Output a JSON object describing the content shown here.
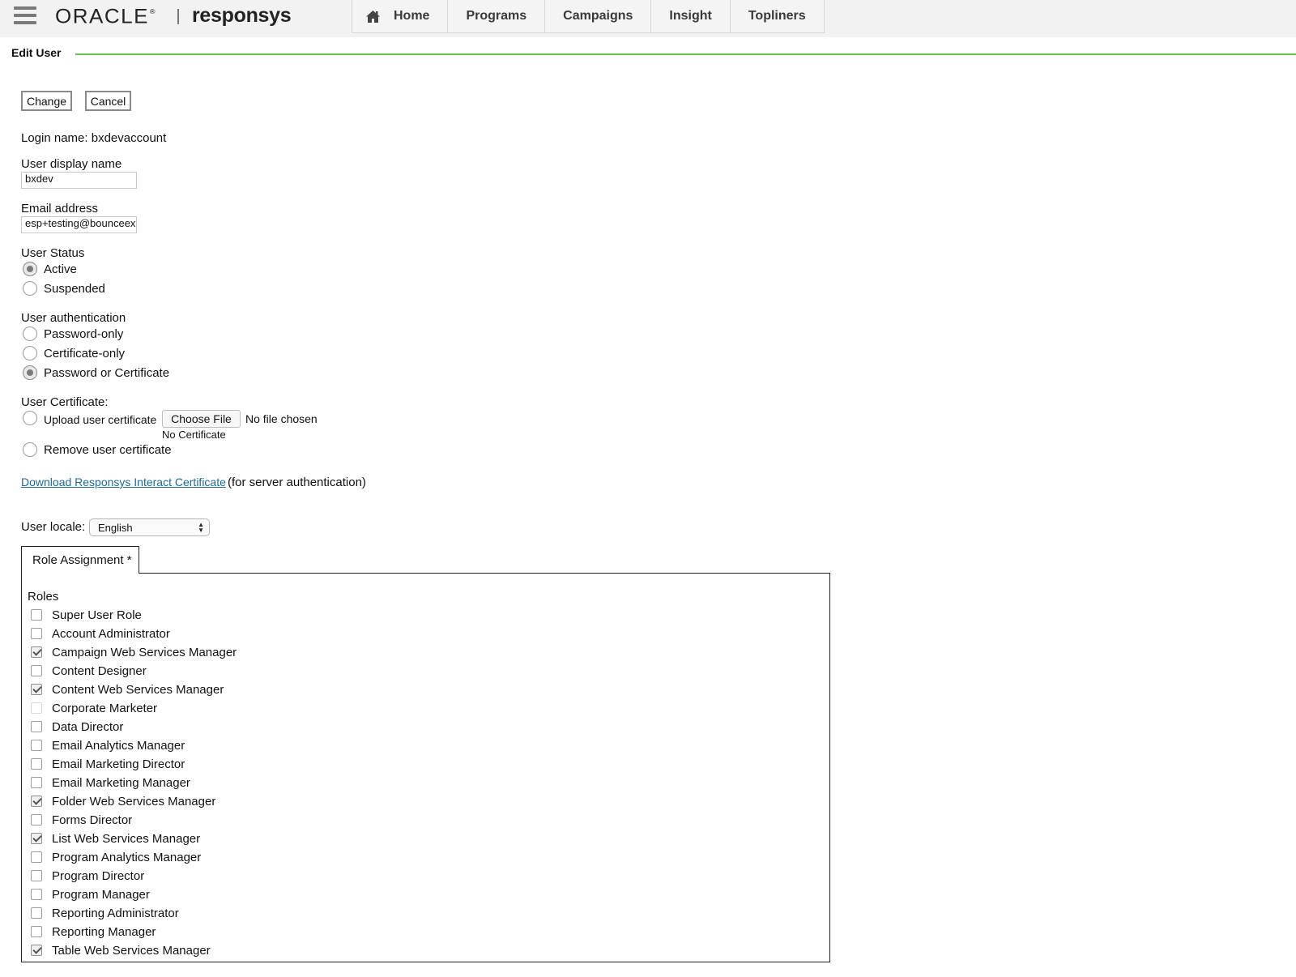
{
  "header": {
    "logo_oracle": "ORACLE",
    "logo_responsys": "responsys",
    "nav": [
      {
        "label": "Home"
      },
      {
        "label": "Programs"
      },
      {
        "label": "Campaigns"
      },
      {
        "label": "Insight"
      },
      {
        "label": "Topliners"
      }
    ]
  },
  "page": {
    "title": "Edit User"
  },
  "actions": {
    "change_label": "Change",
    "cancel_label": "Cancel"
  },
  "form": {
    "login_name": "Login name: bxdevaccount",
    "display_name_label": "User display name",
    "display_name_value": "bxdev",
    "email_label": "Email address",
    "email_value": "esp+testing@bounceexchange.com",
    "status_label": "User Status",
    "status_options": [
      {
        "label": "Active",
        "checked": true
      },
      {
        "label": "Suspended",
        "checked": false
      }
    ],
    "auth_label": "User authentication",
    "auth_options": [
      {
        "label": "Password-only",
        "checked": false
      },
      {
        "label": "Certificate-only",
        "checked": false
      },
      {
        "label": "Password or Certificate",
        "checked": true
      }
    ],
    "certificate_label": "User Certificate:",
    "upload_label": "Upload user certificate",
    "choose_file_label": "Choose File",
    "no_file_text": "No file chosen",
    "no_certificate_text": "No Certificate",
    "remove_label": "Remove user certificate",
    "download_link": "Download Responsys Interact Certificate",
    "download_note": "(for server authentication)",
    "locale_label": "User locale:",
    "locale_value": "English"
  },
  "roles": {
    "tab_label": "Role Assignment *",
    "title": "Roles",
    "items": [
      {
        "label": "Super User Role",
        "checked": false
      },
      {
        "label": "Account Administrator",
        "checked": false
      },
      {
        "label": "Campaign Web Services Manager",
        "checked": true
      },
      {
        "label": "Content Designer",
        "checked": false
      },
      {
        "label": "Content Web Services Manager",
        "checked": true
      },
      {
        "label": "Corporate Marketer",
        "checked": false
      },
      {
        "label": "Data Director",
        "checked": false
      },
      {
        "label": "Email Analytics Manager",
        "checked": false
      },
      {
        "label": "Email Marketing Director",
        "checked": false
      },
      {
        "label": "Email Marketing Manager",
        "checked": false
      },
      {
        "label": "Folder Web Services Manager",
        "checked": true
      },
      {
        "label": "Forms Director",
        "checked": false
      },
      {
        "label": "List Web Services Manager",
        "checked": true
      },
      {
        "label": "Program Analytics Manager",
        "checked": false
      },
      {
        "label": "Program Director",
        "checked": false
      },
      {
        "label": "Program Manager",
        "checked": false
      },
      {
        "label": "Reporting Administrator",
        "checked": false
      },
      {
        "label": "Reporting Manager",
        "checked": false
      },
      {
        "label": "Table Web Services Manager",
        "checked": true
      }
    ]
  },
  "colors": {
    "accent_line": "#6cc24a",
    "link": "#1a6a9a",
    "header_bg": "#f2f2f2"
  }
}
